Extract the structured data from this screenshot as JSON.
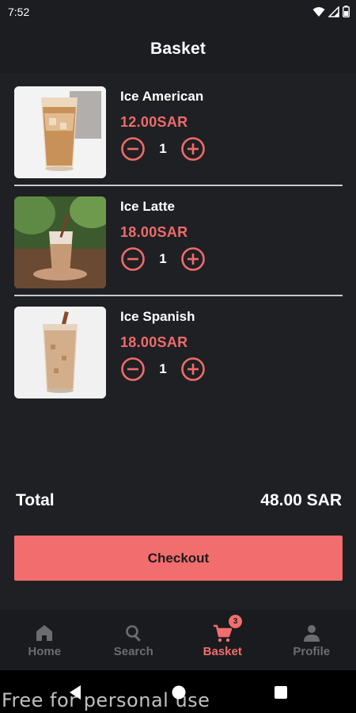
{
  "status_bar": {
    "time": "7:52",
    "icons": [
      "wifi-icon",
      "signal-icon",
      "battery-icon"
    ]
  },
  "header": {
    "title": "Basket"
  },
  "cart": {
    "items": [
      {
        "name": "Ice American",
        "price": "12.00SAR",
        "quantity": "1",
        "image": "iced-coffee-glass"
      },
      {
        "name": "Ice Latte",
        "price": "18.00SAR",
        "quantity": "1",
        "image": "iced-latte-glass"
      },
      {
        "name": "Ice Spanish",
        "price": "18.00SAR",
        "quantity": "1",
        "image": "iced-spanish-latte-glass"
      }
    ]
  },
  "summary": {
    "total_label": "Total",
    "total_value": "48.00 SAR"
  },
  "checkout": {
    "label": "Checkout"
  },
  "bottom_nav": {
    "items": [
      {
        "label": "Home",
        "icon": "home-icon",
        "active": false
      },
      {
        "label": "Search",
        "icon": "search-icon",
        "active": false
      },
      {
        "label": "Basket",
        "icon": "cart-icon",
        "active": true,
        "badge": "3"
      },
      {
        "label": "Profile",
        "icon": "person-icon",
        "active": false
      }
    ]
  },
  "watermark": "Free for personal use",
  "colors": {
    "accent": "#f26d6d",
    "background": "#1f2023",
    "inactive": "#6b6c70"
  }
}
